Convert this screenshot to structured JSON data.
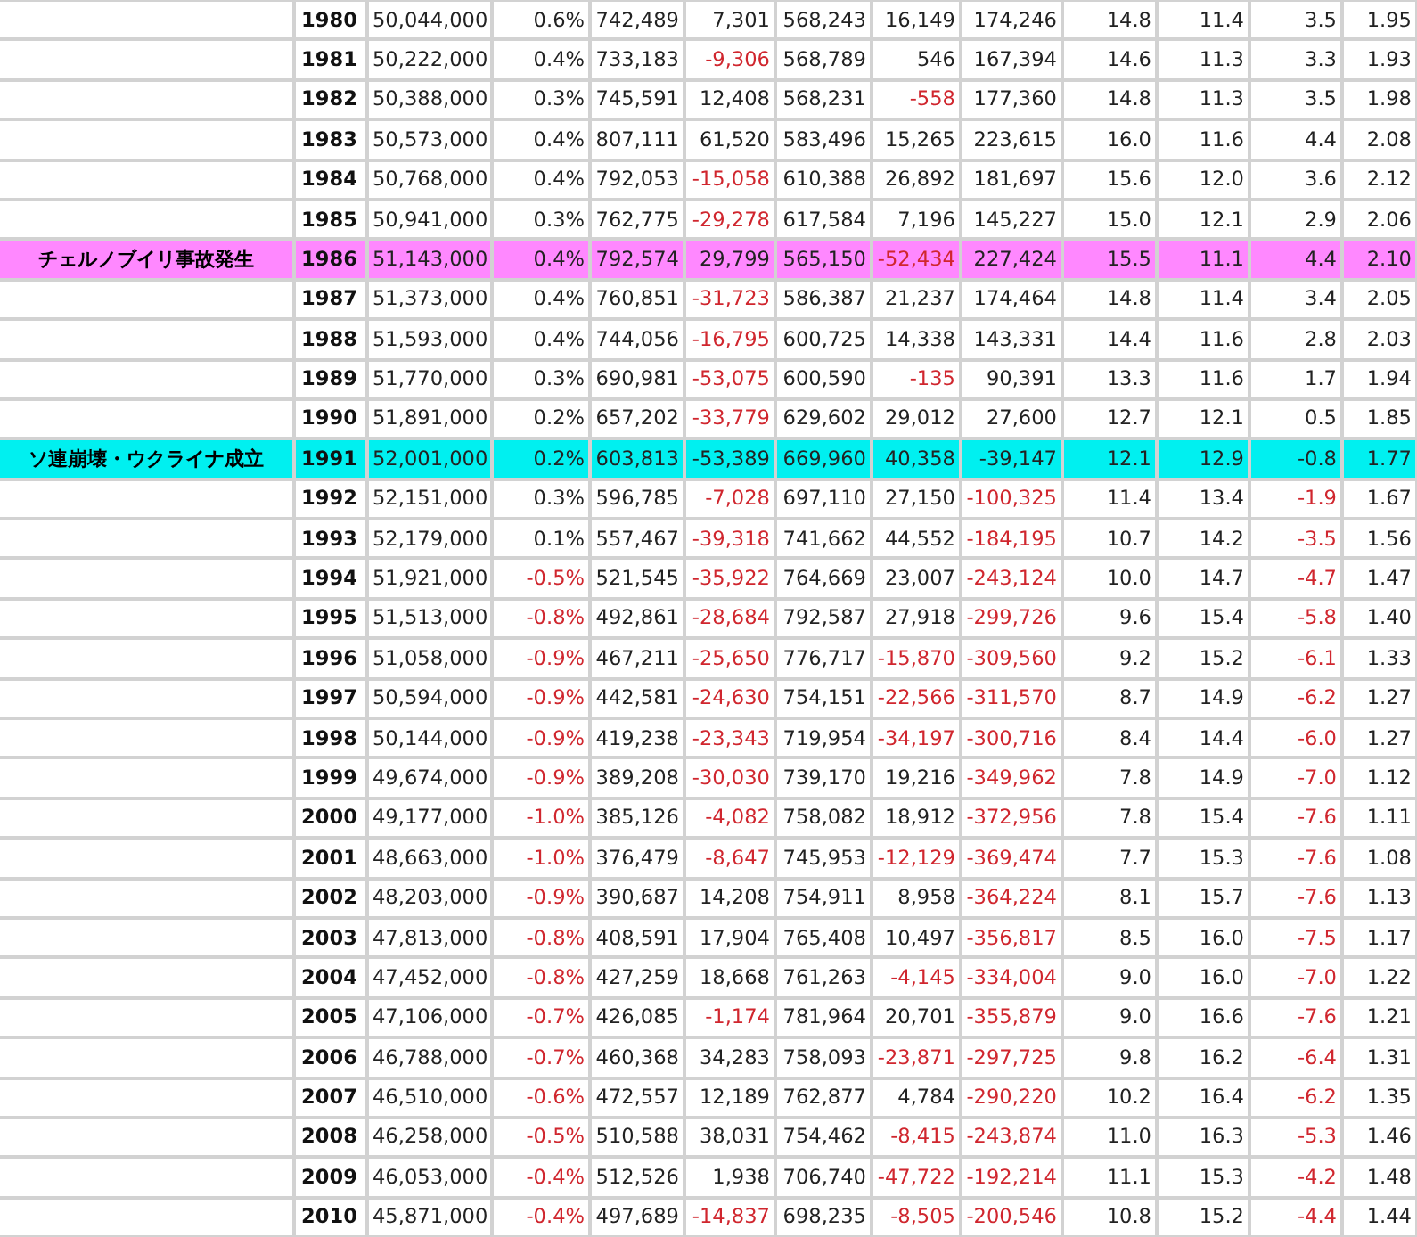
{
  "table": {
    "rows": [
      {
        "year": "1980",
        "cells": [
          "50,044,000",
          "0.6%",
          "742,489",
          "7,301",
          "568,243",
          "16,149",
          "174,246",
          "14.8",
          "11.4",
          "3.5",
          "1.95"
        ],
        "red": [
          false,
          false,
          false,
          false,
          false,
          false,
          false,
          false,
          false,
          false,
          false
        ]
      },
      {
        "year": "1981",
        "cells": [
          "50,222,000",
          "0.4%",
          "733,183",
          "-9,306",
          "568,789",
          "546",
          "167,394",
          "14.6",
          "11.3",
          "3.3",
          "1.93"
        ],
        "red": [
          false,
          false,
          false,
          true,
          false,
          false,
          false,
          false,
          false,
          false,
          false
        ]
      },
      {
        "year": "1982",
        "cells": [
          "50,388,000",
          "0.3%",
          "745,591",
          "12,408",
          "568,231",
          "-558",
          "177,360",
          "14.8",
          "11.3",
          "3.5",
          "1.98"
        ],
        "red": [
          false,
          false,
          false,
          false,
          false,
          true,
          false,
          false,
          false,
          false,
          false
        ]
      },
      {
        "year": "1983",
        "cells": [
          "50,573,000",
          "0.4%",
          "807,111",
          "61,520",
          "583,496",
          "15,265",
          "223,615",
          "16.0",
          "11.6",
          "4.4",
          "2.08"
        ],
        "red": [
          false,
          false,
          false,
          false,
          false,
          false,
          false,
          false,
          false,
          false,
          false
        ]
      },
      {
        "year": "1984",
        "cells": [
          "50,768,000",
          "0.4%",
          "792,053",
          "-15,058",
          "610,388",
          "26,892",
          "181,697",
          "15.6",
          "12.0",
          "3.6",
          "2.12"
        ],
        "red": [
          false,
          false,
          false,
          true,
          false,
          false,
          false,
          false,
          false,
          false,
          false
        ]
      },
      {
        "year": "1985",
        "cells": [
          "50,941,000",
          "0.3%",
          "762,775",
          "-29,278",
          "617,584",
          "7,196",
          "145,227",
          "15.0",
          "12.1",
          "2.9",
          "2.06"
        ],
        "red": [
          false,
          false,
          false,
          true,
          false,
          false,
          false,
          false,
          false,
          false,
          false
        ]
      },
      {
        "year": "1986",
        "label": "チェルノブイリ事故発生",
        "color": "#ff88ff",
        "cells": [
          "51,143,000",
          "0.4%",
          "792,574",
          "29,799",
          "565,150",
          "-52,434",
          "227,424",
          "15.5",
          "11.1",
          "4.4",
          "2.10"
        ],
        "red": [
          false,
          false,
          false,
          false,
          false,
          true,
          false,
          false,
          false,
          false,
          false
        ]
      },
      {
        "year": "1987",
        "cells": [
          "51,373,000",
          "0.4%",
          "760,851",
          "-31,723",
          "586,387",
          "21,237",
          "174,464",
          "14.8",
          "11.4",
          "3.4",
          "2.05"
        ],
        "red": [
          false,
          false,
          false,
          true,
          false,
          false,
          false,
          false,
          false,
          false,
          false
        ]
      },
      {
        "year": "1988",
        "cells": [
          "51,593,000",
          "0.4%",
          "744,056",
          "-16,795",
          "600,725",
          "14,338",
          "143,331",
          "14.4",
          "11.6",
          "2.8",
          "2.03"
        ],
        "red": [
          false,
          false,
          false,
          true,
          false,
          false,
          false,
          false,
          false,
          false,
          false
        ]
      },
      {
        "year": "1989",
        "cells": [
          "51,770,000",
          "0.3%",
          "690,981",
          "-53,075",
          "600,590",
          "-135",
          "90,391",
          "13.3",
          "11.6",
          "1.7",
          "1.94"
        ],
        "red": [
          false,
          false,
          false,
          true,
          false,
          true,
          false,
          false,
          false,
          false,
          false
        ]
      },
      {
        "year": "1990",
        "cells": [
          "51,891,000",
          "0.2%",
          "657,202",
          "-33,779",
          "629,602",
          "29,012",
          "27,600",
          "12.7",
          "12.1",
          "0.5",
          "1.85"
        ],
        "red": [
          false,
          false,
          false,
          true,
          false,
          false,
          false,
          false,
          false,
          false,
          false
        ]
      },
      {
        "year": "1991",
        "label": "ソ連崩壊・ウクライナ成立",
        "color": "#00f0f0",
        "cells": [
          "52,001,000",
          "0.2%",
          "603,813",
          "-53,389",
          "669,960",
          "40,358",
          "-39,147",
          "12.1",
          "12.9",
          "-0.8",
          "1.77"
        ],
        "red": [
          false,
          false,
          false,
          false,
          false,
          false,
          false,
          false,
          false,
          false,
          false
        ]
      },
      {
        "year": "1992",
        "cells": [
          "52,151,000",
          "0.3%",
          "596,785",
          "-7,028",
          "697,110",
          "27,150",
          "-100,325",
          "11.4",
          "13.4",
          "-1.9",
          "1.67"
        ],
        "red": [
          false,
          false,
          false,
          true,
          false,
          false,
          true,
          false,
          false,
          true,
          false
        ]
      },
      {
        "year": "1993",
        "cells": [
          "52,179,000",
          "0.1%",
          "557,467",
          "-39,318",
          "741,662",
          "44,552",
          "-184,195",
          "10.7",
          "14.2",
          "-3.5",
          "1.56"
        ],
        "red": [
          false,
          false,
          false,
          true,
          false,
          false,
          true,
          false,
          false,
          true,
          false
        ]
      },
      {
        "year": "1994",
        "cells": [
          "51,921,000",
          "-0.5%",
          "521,545",
          "-35,922",
          "764,669",
          "23,007",
          "-243,124",
          "10.0",
          "14.7",
          "-4.7",
          "1.47"
        ],
        "red": [
          false,
          true,
          false,
          true,
          false,
          false,
          true,
          false,
          false,
          true,
          false
        ]
      },
      {
        "year": "1995",
        "cells": [
          "51,513,000",
          "-0.8%",
          "492,861",
          "-28,684",
          "792,587",
          "27,918",
          "-299,726",
          "9.6",
          "15.4",
          "-5.8",
          "1.40"
        ],
        "red": [
          false,
          true,
          false,
          true,
          false,
          false,
          true,
          false,
          false,
          true,
          false
        ]
      },
      {
        "year": "1996",
        "cells": [
          "51,058,000",
          "-0.9%",
          "467,211",
          "-25,650",
          "776,717",
          "-15,870",
          "-309,560",
          "9.2",
          "15.2",
          "-6.1",
          "1.33"
        ],
        "red": [
          false,
          true,
          false,
          true,
          false,
          true,
          true,
          false,
          false,
          true,
          false
        ]
      },
      {
        "year": "1997",
        "cells": [
          "50,594,000",
          "-0.9%",
          "442,581",
          "-24,630",
          "754,151",
          "-22,566",
          "-311,570",
          "8.7",
          "14.9",
          "-6.2",
          "1.27"
        ],
        "red": [
          false,
          true,
          false,
          true,
          false,
          true,
          true,
          false,
          false,
          true,
          false
        ]
      },
      {
        "year": "1998",
        "cells": [
          "50,144,000",
          "-0.9%",
          "419,238",
          "-23,343",
          "719,954",
          "-34,197",
          "-300,716",
          "8.4",
          "14.4",
          "-6.0",
          "1.27"
        ],
        "red": [
          false,
          true,
          false,
          true,
          false,
          true,
          true,
          false,
          false,
          true,
          false
        ]
      },
      {
        "year": "1999",
        "cells": [
          "49,674,000",
          "-0.9%",
          "389,208",
          "-30,030",
          "739,170",
          "19,216",
          "-349,962",
          "7.8",
          "14.9",
          "-7.0",
          "1.12"
        ],
        "red": [
          false,
          true,
          false,
          true,
          false,
          false,
          true,
          false,
          false,
          true,
          false
        ]
      },
      {
        "year": "2000",
        "cells": [
          "49,177,000",
          "-1.0%",
          "385,126",
          "-4,082",
          "758,082",
          "18,912",
          "-372,956",
          "7.8",
          "15.4",
          "-7.6",
          "1.11"
        ],
        "red": [
          false,
          true,
          false,
          true,
          false,
          false,
          true,
          false,
          false,
          true,
          false
        ]
      },
      {
        "year": "2001",
        "cells": [
          "48,663,000",
          "-1.0%",
          "376,479",
          "-8,647",
          "745,953",
          "-12,129",
          "-369,474",
          "7.7",
          "15.3",
          "-7.6",
          "1.08"
        ],
        "red": [
          false,
          true,
          false,
          true,
          false,
          true,
          true,
          false,
          false,
          true,
          false
        ]
      },
      {
        "year": "2002",
        "cells": [
          "48,203,000",
          "-0.9%",
          "390,687",
          "14,208",
          "754,911",
          "8,958",
          "-364,224",
          "8.1",
          "15.7",
          "-7.6",
          "1.13"
        ],
        "red": [
          false,
          true,
          false,
          false,
          false,
          false,
          true,
          false,
          false,
          true,
          false
        ]
      },
      {
        "year": "2003",
        "cells": [
          "47,813,000",
          "-0.8%",
          "408,591",
          "17,904",
          "765,408",
          "10,497",
          "-356,817",
          "8.5",
          "16.0",
          "-7.5",
          "1.17"
        ],
        "red": [
          false,
          true,
          false,
          false,
          false,
          false,
          true,
          false,
          false,
          true,
          false
        ]
      },
      {
        "year": "2004",
        "cells": [
          "47,452,000",
          "-0.8%",
          "427,259",
          "18,668",
          "761,263",
          "-4,145",
          "-334,004",
          "9.0",
          "16.0",
          "-7.0",
          "1.22"
        ],
        "red": [
          false,
          true,
          false,
          false,
          false,
          true,
          true,
          false,
          false,
          true,
          false
        ]
      },
      {
        "year": "2005",
        "cells": [
          "47,106,000",
          "-0.7%",
          "426,085",
          "-1,174",
          "781,964",
          "20,701",
          "-355,879",
          "9.0",
          "16.6",
          "-7.6",
          "1.21"
        ],
        "red": [
          false,
          true,
          false,
          true,
          false,
          false,
          true,
          false,
          false,
          true,
          false
        ]
      },
      {
        "year": "2006",
        "cells": [
          "46,788,000",
          "-0.7%",
          "460,368",
          "34,283",
          "758,093",
          "-23,871",
          "-297,725",
          "9.8",
          "16.2",
          "-6.4",
          "1.31"
        ],
        "red": [
          false,
          true,
          false,
          false,
          false,
          true,
          true,
          false,
          false,
          true,
          false
        ]
      },
      {
        "year": "2007",
        "cells": [
          "46,510,000",
          "-0.6%",
          "472,557",
          "12,189",
          "762,877",
          "4,784",
          "-290,220",
          "10.2",
          "16.4",
          "-6.2",
          "1.35"
        ],
        "red": [
          false,
          true,
          false,
          false,
          false,
          false,
          true,
          false,
          false,
          true,
          false
        ]
      },
      {
        "year": "2008",
        "cells": [
          "46,258,000",
          "-0.5%",
          "510,588",
          "38,031",
          "754,462",
          "-8,415",
          "-243,874",
          "11.0",
          "16.3",
          "-5.3",
          "1.46"
        ],
        "red": [
          false,
          true,
          false,
          false,
          false,
          true,
          true,
          false,
          false,
          true,
          false
        ]
      },
      {
        "year": "2009",
        "cells": [
          "46,053,000",
          "-0.4%",
          "512,526",
          "1,938",
          "706,740",
          "-47,722",
          "-192,214",
          "11.1",
          "15.3",
          "-4.2",
          "1.48"
        ],
        "red": [
          false,
          true,
          false,
          false,
          false,
          true,
          true,
          false,
          false,
          true,
          false
        ]
      },
      {
        "year": "2010",
        "cells": [
          "45,871,000",
          "-0.4%",
          "497,689",
          "-14,837",
          "698,235",
          "-8,505",
          "-200,546",
          "10.8",
          "15.2",
          "-4.4",
          "1.44"
        ],
        "red": [
          false,
          true,
          false,
          true,
          false,
          true,
          true,
          false,
          false,
          true,
          false
        ]
      }
    ]
  }
}
